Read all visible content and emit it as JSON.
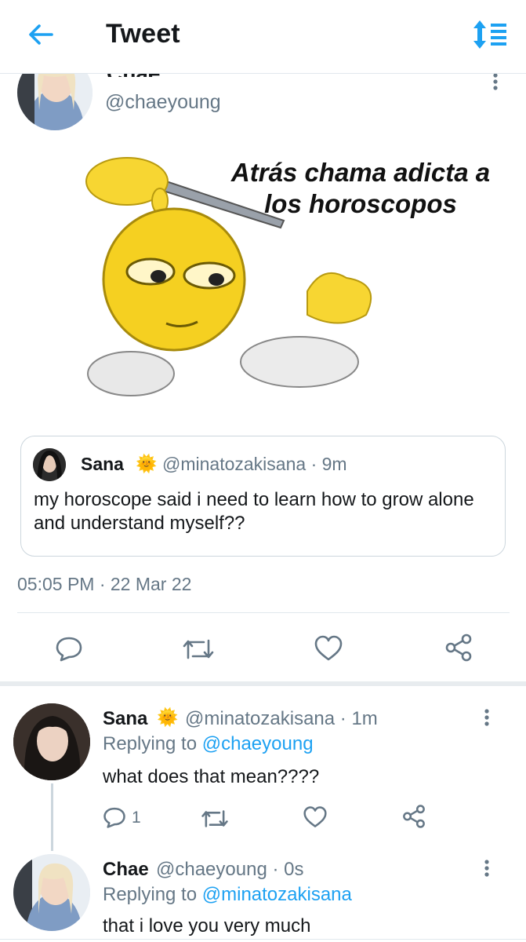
{
  "header": {
    "title": "Tweet",
    "back_icon": "arrow-left-icon",
    "sort_icon": "sort-icon",
    "accent": "#1da1f2"
  },
  "main_tweet": {
    "partial_name": "Chae",
    "handle": "@chaeyoung",
    "meme_caption": "Atrás chama adicta a los horoscopos",
    "quote": {
      "name": "Sana",
      "badge": "🌞",
      "handle": "@minatozakisana",
      "time": "· 9m",
      "text": "my horoscope said i need to learn how to grow alone and understand myself??"
    },
    "timestamp": "05:05 PM · 22 Mar 22"
  },
  "actions": [
    "reply-icon",
    "retweet-icon",
    "like-icon",
    "share-icon"
  ],
  "replies": [
    {
      "name": "Sana",
      "badge": "🌞",
      "handle": "@minatozakisana",
      "time": "· 1m",
      "replying_prefix": "Replying to",
      "replying_to": "@chaeyoung",
      "text": "what does that mean????",
      "reply_count": "1"
    },
    {
      "name": "Chae",
      "handle": "@chaeyoung",
      "time": "· 0s",
      "replying_prefix": "Replying to",
      "replying_to": "@minatozakisana",
      "text": "that i love you very much"
    }
  ]
}
